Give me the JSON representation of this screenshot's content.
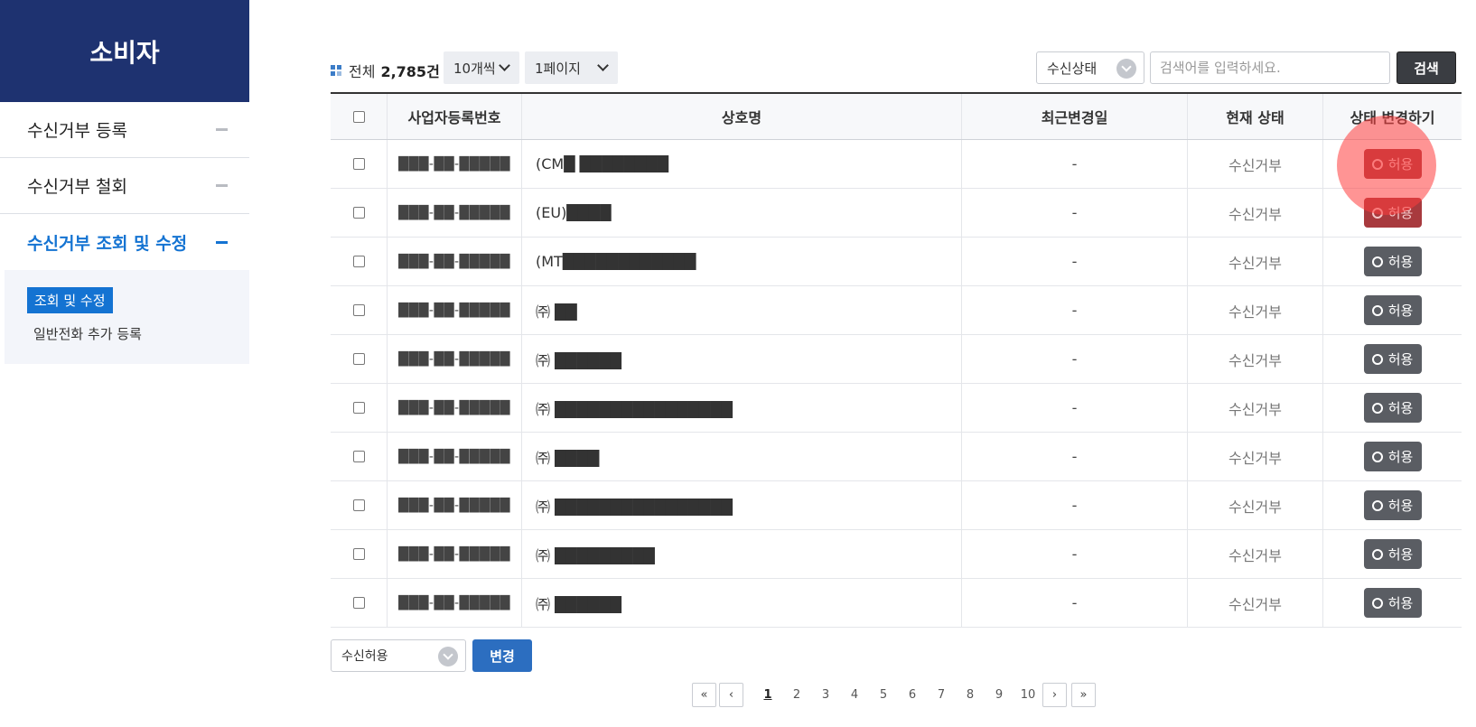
{
  "sidebar": {
    "brand": "소비자",
    "menu": [
      {
        "label": "수신거부 등록"
      },
      {
        "label": "수신거부 철회"
      },
      {
        "label": "수신거부 조회 및 수정"
      }
    ],
    "submenu": {
      "active": "조회 및 수정",
      "other": "일반전화 추가 등록"
    }
  },
  "toolbar": {
    "total_label": "전체",
    "total_count": "2,785건",
    "per_page": "10개씩",
    "page": "1페이지",
    "status_select": "수신상태",
    "search_placeholder": "검색어를 입력하세요.",
    "search_button": "검색"
  },
  "table": {
    "headers": [
      "사업자등록번호",
      "상호명",
      "최근변경일",
      "현재 상태",
      "상태 변경하기"
    ],
    "rows": [
      {
        "biz_no": "███-██-█████",
        "name": "(CM█ ████████",
        "date": "-",
        "status": "수신거부",
        "action": "허용"
      },
      {
        "biz_no": "███-██-█████",
        "name": "(EU)████",
        "date": "-",
        "status": "수신거부",
        "action": "허용"
      },
      {
        "biz_no": "███-██-█████",
        "name": "(MT████████████",
        "date": "-",
        "status": "수신거부",
        "action": "허용"
      },
      {
        "biz_no": "███-██-█████",
        "name": "㈜ ██",
        "date": "-",
        "status": "수신거부",
        "action": "허용"
      },
      {
        "biz_no": "███-██-█████",
        "name": "㈜ ██████",
        "date": "-",
        "status": "수신거부",
        "action": "허용"
      },
      {
        "biz_no": "███-██-█████",
        "name": "㈜ ████████████████",
        "date": "-",
        "status": "수신거부",
        "action": "허용"
      },
      {
        "biz_no": "███-██-█████",
        "name": "㈜ ████",
        "date": "-",
        "status": "수신거부",
        "action": "허용"
      },
      {
        "biz_no": "███-██-█████",
        "name": "㈜ ████████████████",
        "date": "-",
        "status": "수신거부",
        "action": "허용"
      },
      {
        "biz_no": "███-██-█████",
        "name": "㈜ █████████",
        "date": "-",
        "status": "수신거부",
        "action": "허용"
      },
      {
        "biz_no": "███-██-█████",
        "name": "㈜ ██████",
        "date": "-",
        "status": "수신거부",
        "action": "허용"
      }
    ]
  },
  "bottom": {
    "select": "수신허용",
    "change_button": "변경"
  },
  "pagination": {
    "first": "«",
    "prev": "‹",
    "next": "›",
    "last": "»",
    "pages": [
      "1",
      "2",
      "3",
      "4",
      "5",
      "6",
      "7",
      "8",
      "9",
      "10"
    ],
    "current": "1"
  }
}
